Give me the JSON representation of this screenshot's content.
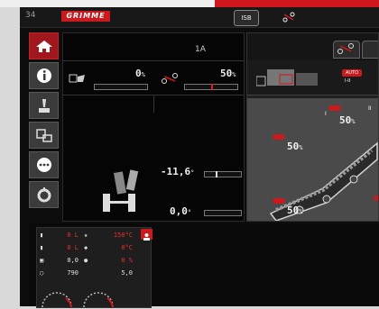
{
  "header": {
    "number": "34",
    "logo_text": "GRIMME",
    "isb_label": "ISB"
  },
  "sidebar": {
    "items": [
      {
        "name": "home",
        "active": true
      },
      {
        "name": "info",
        "active": false
      },
      {
        "name": "joystick",
        "active": false
      },
      {
        "name": "machine",
        "active": false
      },
      {
        "name": "more",
        "active": false
      },
      {
        "name": "settings",
        "active": false
      }
    ]
  },
  "panel_left": {
    "label": "1A",
    "bunker_value": "0",
    "bunker_unit": "%",
    "bunker_fill": 0.0,
    "speed_value": "50",
    "speed_unit": "%",
    "speed_level": 0.5,
    "tilt_value": "-11,6",
    "tilt_unit": "°",
    "tilt_level": 0.3,
    "slope_value": "0,0",
    "slope_unit": "°",
    "slope_level": 0.0
  },
  "panel_right": {
    "auto_label": "AUTO",
    "mode_label": "I-II",
    "conv_values": [
      {
        "label": "I",
        "value": "50",
        "unit": "%"
      },
      {
        "label": "II",
        "value": "50",
        "unit": "%"
      },
      {
        "label": "",
        "value": "50",
        "unit": "%"
      },
      {
        "label": "",
        "value": "50",
        "unit": "%"
      }
    ]
  },
  "bottom_list": [
    {
      "c1": "0",
      "u1": "L",
      "c2": "150",
      "u2": "°C",
      "c1_red": true,
      "c2_red": true
    },
    {
      "c1": "0",
      "u1": "L",
      "c2": "0",
      "u2": "°C",
      "c1_red": true,
      "c2_red": true
    },
    {
      "c1": "0,0",
      "u1": "",
      "c2": "0",
      "u2": "%",
      "c1_red": false,
      "c2_red": true
    },
    {
      "c1": "790",
      "u1": "",
      "c2": "5,0",
      "u2": "",
      "c1_red": false,
      "c2_red": false
    }
  ],
  "colors": {
    "accent": "#c81a1f",
    "panel": "#050505",
    "sidebar_button": "#3b3b3b"
  }
}
